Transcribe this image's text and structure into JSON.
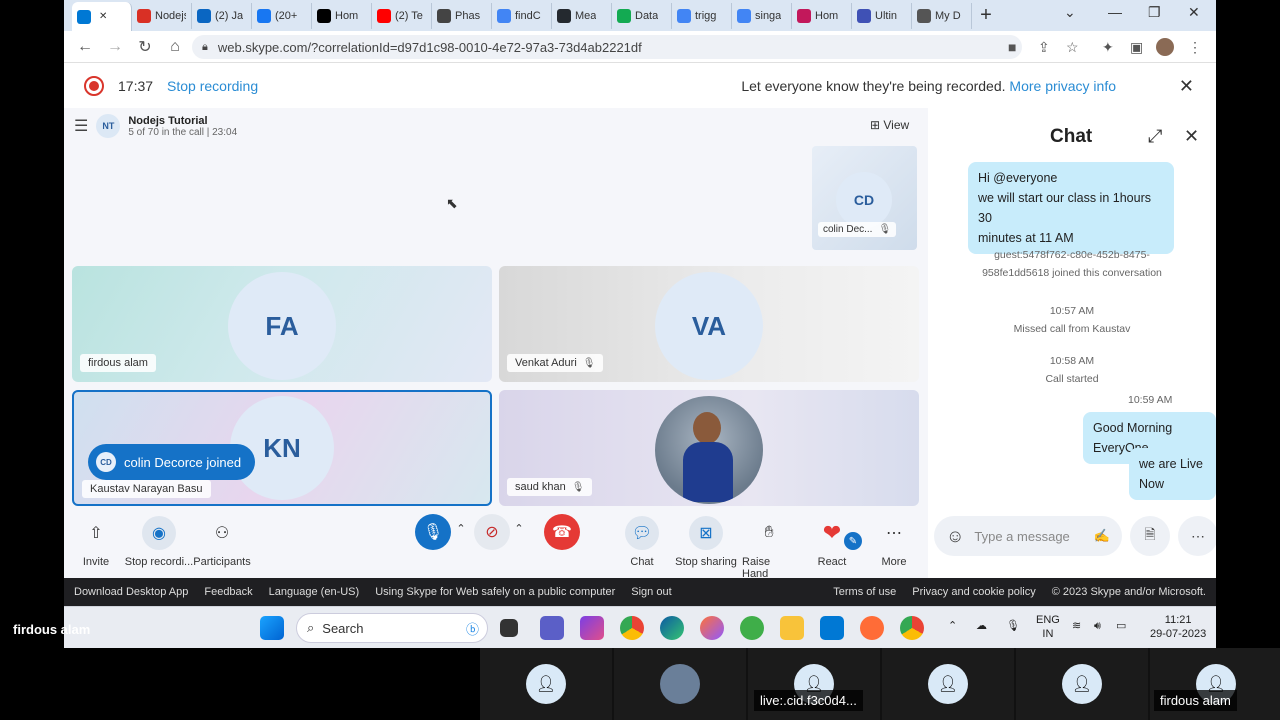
{
  "browser": {
    "tabs": [
      {
        "label": "",
        "icon": "skype-icon",
        "color": "#0078d4",
        "active": true
      },
      {
        "label": "Nodejs",
        "icon": "gmail-icon",
        "color": "#d93025"
      },
      {
        "label": "(2) Ja",
        "icon": "linkedin-icon",
        "color": "#0a66c2"
      },
      {
        "label": "(20+",
        "icon": "facebook-icon",
        "color": "#1877f2"
      },
      {
        "label": "Hom",
        "icon": "x-icon",
        "color": "#000000"
      },
      {
        "label": "(2) Te",
        "icon": "youtube-icon",
        "color": "#ff0000"
      },
      {
        "label": "Phas",
        "icon": "document-icon",
        "color": "#444444"
      },
      {
        "label": "findC",
        "icon": "google-icon",
        "color": "#4285f4"
      },
      {
        "label": "Mea",
        "icon": "github-icon",
        "color": "#24292f"
      },
      {
        "label": "Data",
        "icon": "mongodb-icon",
        "color": "#13aa52"
      },
      {
        "label": "trigg",
        "icon": "google-icon",
        "color": "#4285f4"
      },
      {
        "label": "singa",
        "icon": "google-icon",
        "color": "#4285f4"
      },
      {
        "label": "Hom",
        "icon": "home-icon",
        "color": "#c2185b"
      },
      {
        "label": "Ultin",
        "icon": "tata-icon",
        "color": "#3f51b5"
      },
      {
        "label": "My D",
        "icon": "globe-icon",
        "color": "#555555"
      }
    ],
    "url": "web.skype.com/?correlationId=d97d1c98-0010-4e72-97a3-73d4ab2221df"
  },
  "recording": {
    "time": "17:37",
    "stop_label": "Stop recording",
    "notice": "Let everyone know they're being recorded.",
    "privacy_link": "More privacy info"
  },
  "call": {
    "title": "Nodejs Tutorial",
    "subtitle": "5 of 70 in the call | 23:04",
    "view_label": "View",
    "thumb": {
      "initials": "CD",
      "name": "colin Dec..."
    },
    "tiles": [
      {
        "initials": "FA",
        "name": "firdous alam"
      },
      {
        "initials": "VA",
        "name": "Venkat Aduri"
      },
      {
        "initials": "KN",
        "name": "Kaustav Narayan Basu"
      },
      {
        "initials": "",
        "name": "saud khan"
      }
    ],
    "joined_toast": {
      "initials": "CD",
      "text": "colin Decorce joined"
    }
  },
  "controls": {
    "invite": "Invite",
    "stop_recording": "Stop recordi...",
    "participants": "Participants",
    "chat": "Chat",
    "stop_sharing": "Stop sharing",
    "raise_hand": "Raise Hand",
    "react": "React",
    "more": "More"
  },
  "footer": {
    "links": [
      "Download Desktop App",
      "Feedback",
      "Language (en-US)",
      "Using Skype for Web safely on a public computer",
      "Sign out"
    ],
    "terms": "Terms of use",
    "privacy": "Privacy and cookie policy",
    "copyright": "© 2023 Skype and/or Microsoft."
  },
  "taskbar": {
    "search": "Search",
    "lang1": "ENG",
    "lang2": "IN",
    "time": "11:21",
    "date": "29-07-2023"
  },
  "chat": {
    "title": "Chat",
    "msg1_line1": "Hi @everyone",
    "msg1_line2": "we will start our class in 1hours 30",
    "msg1_line3": "minutes at 11 AM",
    "sys1_line1": "guest:5478f762-c80e-452b-8475-",
    "sys1_line2": "958fe1dd5618 joined this conversation",
    "time1": "10:57 AM",
    "missed": "Missed call from Kaustav",
    "time2": "10:58 AM",
    "started": "Call started",
    "time3": "10:59 AM",
    "msg2": "Good Morning EveryOne",
    "msg3": "we are Live Now",
    "placeholder": "Type a message"
  },
  "overlay": {
    "name": "firdous alam",
    "gallery_label1": "live:.cid.f3c0d4...",
    "gallery_label2": "firdous alam"
  }
}
